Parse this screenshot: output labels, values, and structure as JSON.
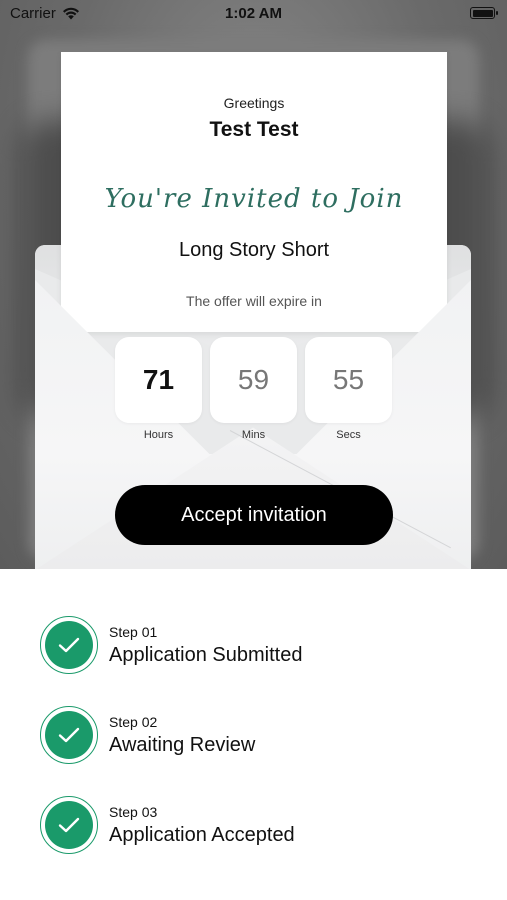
{
  "status_bar": {
    "carrier": "Carrier",
    "time": "1:02 AM"
  },
  "invite": {
    "greeting": "Greetings",
    "name": "Test Test",
    "script_line": "You're Invited to Join",
    "event": "Long Story Short",
    "expire_text": "The offer will expire in",
    "countdown": {
      "hours": {
        "value": "71",
        "label": "Hours"
      },
      "mins": {
        "value": "59",
        "label": "Mins"
      },
      "secs": {
        "value": "55",
        "label": "Secs"
      }
    },
    "accept_label": "Accept invitation"
  },
  "steps": [
    {
      "number": "Step 01",
      "title": "Application Submitted",
      "icon": "check-icon"
    },
    {
      "number": "Step 02",
      "title": "Awaiting Review",
      "icon": "check-icon"
    },
    {
      "number": "Step 03",
      "title": "Application Accepted",
      "icon": "check-icon"
    }
  ],
  "colors": {
    "accent_green": "#1a9a6a",
    "script_green": "#2e6e60",
    "button": "#000000"
  }
}
